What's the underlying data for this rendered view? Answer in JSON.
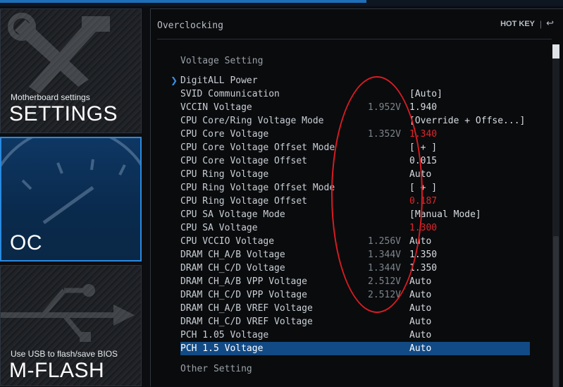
{
  "sidebar": {
    "settings": {
      "sub": "Motherboard settings",
      "title": "SETTINGS"
    },
    "oc": {
      "title": "OC"
    },
    "mflash": {
      "sub": "Use USB to flash/save BIOS",
      "title": "M-FLASH"
    }
  },
  "header": {
    "title": "Overclocking",
    "hotkey": "HOT KEY",
    "separator": "|",
    "back_icon": "back-arrow-icon"
  },
  "sections": {
    "voltage": "Voltage Setting",
    "other": "Other Setting"
  },
  "rows": [
    {
      "label": "DigitALL Power",
      "current": "",
      "value": "",
      "submenu": true
    },
    {
      "label": "SVID Communication",
      "current": "",
      "value": "[Auto]"
    },
    {
      "label": "VCCIN Voltage",
      "current": "1.952V",
      "value": "1.940"
    },
    {
      "label": "CPU Core/Ring Voltage Mode",
      "current": "",
      "value": "[Override + Offse...]"
    },
    {
      "label": "CPU Core Voltage",
      "current": "1.352V",
      "value": "1.340",
      "red": true
    },
    {
      "label": "CPU Core Voltage Offset Mode",
      "current": "",
      "value": "[ + ]"
    },
    {
      "label": "CPU Core Voltage Offset",
      "current": "",
      "value": "0.015"
    },
    {
      "label": "CPU Ring Voltage",
      "current": "",
      "value": "Auto"
    },
    {
      "label": "CPU Ring Voltage Offset Mode",
      "current": "",
      "value": "[ + ]"
    },
    {
      "label": "CPU Ring Voltage Offset",
      "current": "",
      "value": "0.187",
      "red": true
    },
    {
      "label": "CPU SA Voltage Mode",
      "current": "",
      "value": "[Manual Mode]"
    },
    {
      "label": "CPU SA Voltage",
      "current": "",
      "value": "1.300",
      "red": true
    },
    {
      "label": "CPU VCCIO Voltage",
      "current": "1.256V",
      "value": "Auto"
    },
    {
      "label": "DRAM CH_A/B Voltage",
      "current": "1.344V",
      "value": "1.350"
    },
    {
      "label": "DRAM CH_C/D Voltage",
      "current": "1.344V",
      "value": "1.350"
    },
    {
      "label": "DRAM CH_A/B VPP Voltage",
      "current": "2.512V",
      "value": "Auto"
    },
    {
      "label": "DRAM CH_C/D VPP Voltage",
      "current": "2.512V",
      "value": "Auto"
    },
    {
      "label": "DRAM CH_A/B VREF Voltage",
      "current": "",
      "value": "Auto"
    },
    {
      "label": "DRAM CH_C/D VREF Voltage",
      "current": "",
      "value": "Auto"
    },
    {
      "label": "PCH 1.05 Voltage",
      "current": "",
      "value": "Auto"
    },
    {
      "label": "PCH 1.5 Voltage",
      "current": "",
      "value": "Auto",
      "selected": true
    }
  ],
  "colors": {
    "accent": "#124a85",
    "warning_value": "#e0262c",
    "annotation": "#d81c22"
  }
}
